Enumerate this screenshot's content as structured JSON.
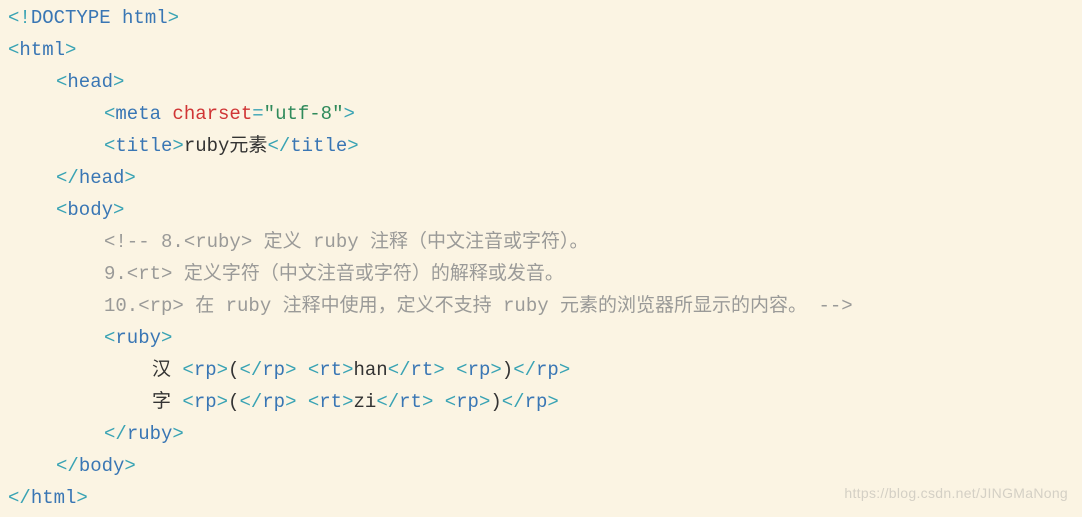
{
  "watermark": "https://blog.csdn.net/JINGMaNong",
  "code": {
    "doctype": {
      "open": "<!",
      "name": "DOCTYPE html",
      "close": ">"
    },
    "html_open": {
      "open": "<",
      "name": "html",
      "close": ">"
    },
    "head_open": {
      "open": "<",
      "name": "head",
      "close": ">"
    },
    "meta": {
      "open": "<",
      "name": "meta",
      "attr": "charset",
      "eq": "=",
      "valq1": "\"",
      "val": "utf-8",
      "valq2": "\"",
      "close": ">"
    },
    "title_open": {
      "open": "<",
      "name": "title",
      "close": ">"
    },
    "title_text": "ruby元素",
    "title_close": {
      "open": "</",
      "name": "title",
      "close": ">"
    },
    "head_close": {
      "open": "</",
      "name": "head",
      "close": ">"
    },
    "body_open": {
      "open": "<",
      "name": "body",
      "close": ">"
    },
    "comment": {
      "open": "<!-- ",
      "l1": "8.<ruby> 定义 ruby 注释（中文注音或字符）。",
      "l2": "9.<rt> 定义字符（中文注音或字符）的解释或发音。",
      "l3": "10.<rp> 在 ruby 注释中使用，定义不支持 ruby 元素的浏览器所显示的内容。 ",
      "close": "-->"
    },
    "ruby_open": {
      "open": "<",
      "name": "ruby",
      "close": ">"
    },
    "row1": {
      "char": "汉 ",
      "rp1o": {
        "open": "<",
        "name": "rp",
        "close": ">"
      },
      "rp1c": {
        "open": "</",
        "name": "rp",
        "close": ">"
      },
      "lp": "(",
      "rt_o": {
        "open": "<",
        "name": "rt",
        "close": ">"
      },
      "rt_t": "han",
      "rt_c": {
        "open": "</",
        "name": "rt",
        "close": ">"
      },
      "rp2o": {
        "open": "<",
        "name": "rp",
        "close": ">"
      },
      "rp2c": {
        "open": "</",
        "name": "rp",
        "close": ">"
      },
      "rpv": ")"
    },
    "row2": {
      "char": "字 ",
      "rp1o": {
        "open": "<",
        "name": "rp",
        "close": ">"
      },
      "rp1c": {
        "open": "</",
        "name": "rp",
        "close": ">"
      },
      "lp": "(",
      "rt_o": {
        "open": "<",
        "name": "rt",
        "close": ">"
      },
      "rt_t": "zi",
      "rt_c": {
        "open": "</",
        "name": "rt",
        "close": ">"
      },
      "rp2o": {
        "open": "<",
        "name": "rp",
        "close": ">"
      },
      "rp2c": {
        "open": "</",
        "name": "rp",
        "close": ">"
      },
      "rpv": ")"
    },
    "ruby_close": {
      "open": "</",
      "name": "ruby",
      "close": ">"
    },
    "body_close": {
      "open": "</",
      "name": "body",
      "close": ">"
    },
    "html_close": {
      "open": "</",
      "name": "html",
      "close": ">"
    }
  }
}
